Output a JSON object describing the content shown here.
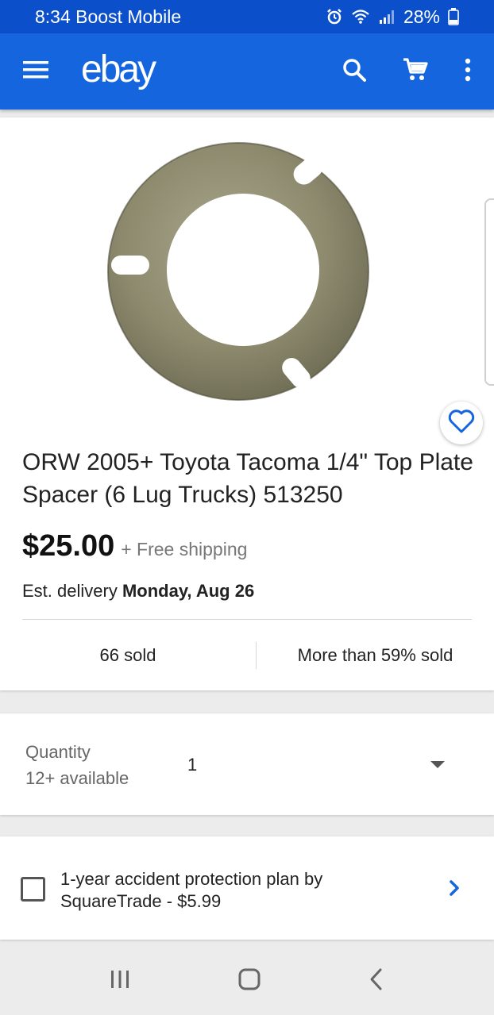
{
  "status_bar": {
    "time_carrier": "8:34 Boost Mobile",
    "battery": "28%",
    "icons": [
      "alarm-icon",
      "wifi-icon",
      "signal-icon",
      "battery-icon"
    ]
  },
  "app_bar": {
    "logo": "ebay",
    "icons": [
      "menu-icon",
      "search-icon",
      "cart-icon",
      "more-vert-icon"
    ],
    "color": "#1565df"
  },
  "product": {
    "image_alt": "spacer-plate-image",
    "title": "ORW 2005+ Toyota Tacoma 1/4\" Top Plate Spacer (6 Lug Trucks) 513250",
    "price": "$25.00",
    "shipping": "+ Free shipping",
    "delivery_prefix": "Est. delivery ",
    "delivery_date": "Monday, Aug 26",
    "sold": "66 sold",
    "sold_percent": "More than 59% sold",
    "accent_color": "#1565df"
  },
  "quantity": {
    "label": "Quantity",
    "available": "12+ available",
    "value": "1"
  },
  "protection": {
    "text": "1-year accident protection plan by SquareTrade - $5.99",
    "checked": false
  },
  "nav_bar": {
    "icons": [
      "recent-apps-icon",
      "home-icon",
      "back-icon"
    ]
  }
}
